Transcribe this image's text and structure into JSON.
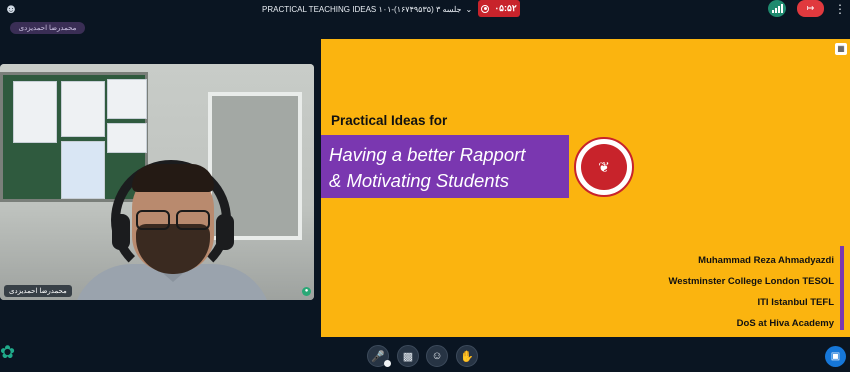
{
  "topbar": {
    "session_title": "PRACTICAL TEACHING IDEAS جلسه ۳ (۱۶۷۴۹۵۳۵)-۱۰۱",
    "timer": "۰۵:۵۲",
    "icons": [
      "user-settings-icon",
      "chevron-down-icon",
      "record-icon",
      "signal-icon",
      "leave-icon",
      "more-icon"
    ],
    "colors": {
      "record": "#c8232b",
      "leave": "#e0393e",
      "signal": "#1f8a6f"
    }
  },
  "presenter_tag": "محمدرضا احمدیزدی",
  "video": {
    "name_tag": "محمدرضا احمدیزدی"
  },
  "slide": {
    "intro": "Practical Ideas for",
    "title_line1": "Having a better Rapport",
    "title_line2": "& Motivating Students",
    "credits": [
      "Muhammad Reza Ahmadyazdi",
      "Westminster College London TESOL",
      "ITI Istanbul TEFL",
      "DoS at Hiva Academy"
    ],
    "colors": {
      "background": "#fbb40f",
      "banner": "#7a37b0"
    }
  },
  "controls": {
    "buttons": [
      "mic-off-icon",
      "camera-off-icon",
      "emoji-icon",
      "raise-hand-icon"
    ],
    "right": "chat-icon",
    "left": "ai-assistant-icon"
  }
}
